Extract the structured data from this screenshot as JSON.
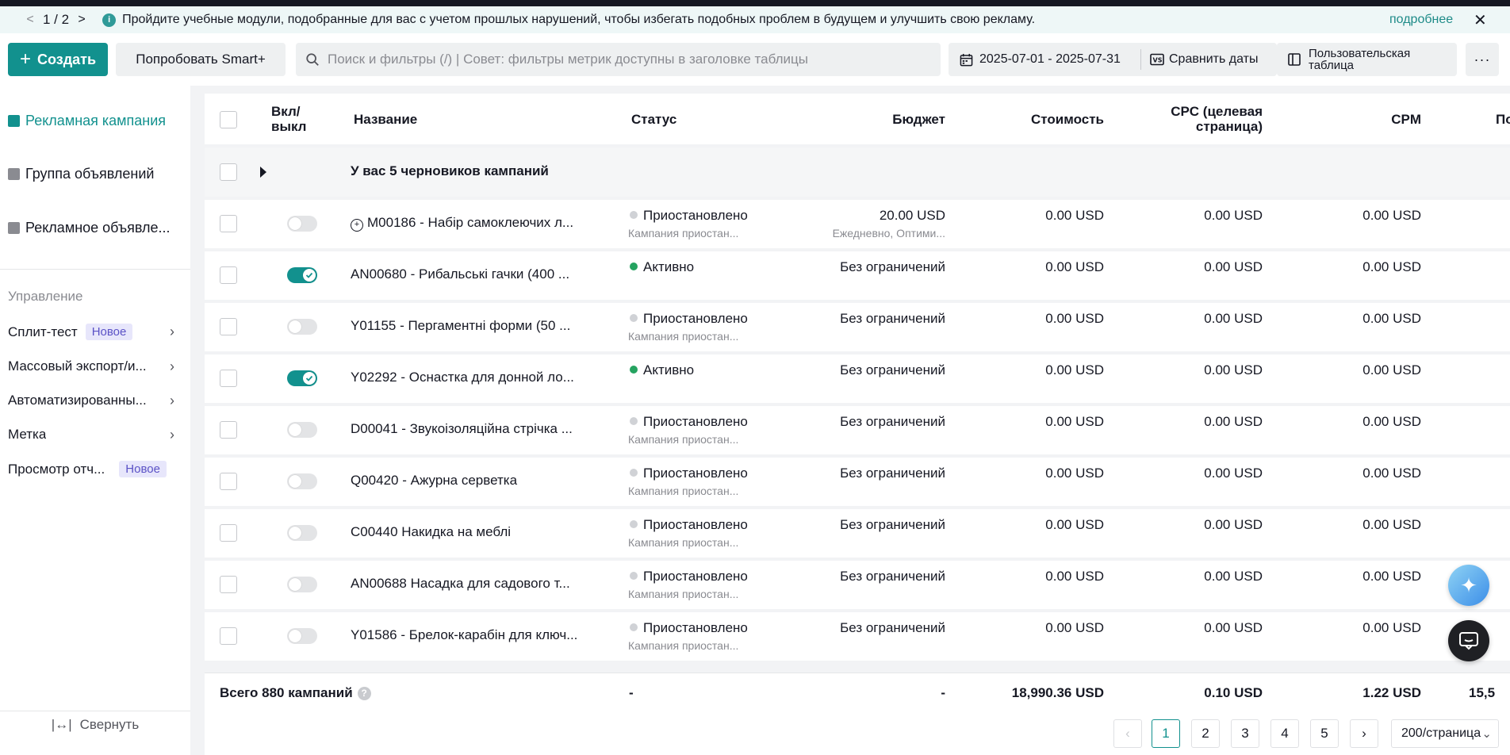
{
  "banner": {
    "page": "1 / 2",
    "message": "Пройдите учебные модули, подобранные для вас с учетом прошлых нарушений, чтобы избегать подобных проблем в будущем и улучшить свою рекламу.",
    "more": "подробнее"
  },
  "toolbar": {
    "create": "Создать",
    "try_smart": "Попробовать Smart+",
    "search_placeholder": "Поиск и фильтры (/) | Совет: фильтры метрик доступны в заголовке таблицы",
    "date_range": "2025-07-01 - 2025-07-31",
    "compare": "Сравнить даты",
    "custom_table": "Пользовательская таблица"
  },
  "sidebar": {
    "levels": [
      "Рекламная кампания",
      "Группа объявлений",
      "Рекламное объявле..."
    ],
    "section": "Управление",
    "links": [
      {
        "label": "Сплит-тест",
        "badge": "Новое"
      },
      {
        "label": "Массовый экспорт/и..."
      },
      {
        "label": "Автоматизированны..."
      },
      {
        "label": "Метка"
      },
      {
        "label": "Просмотр отч...",
        "badge": "Новое"
      }
    ],
    "collapse": "Свернуть"
  },
  "table": {
    "headers": {
      "toggle": "Вкл/ выкл",
      "name": "Название",
      "status": "Статус",
      "budget": "Бюджет",
      "cost": "Стоимость",
      "cpc": "CPC (целевая страница)",
      "cpm": "CPM",
      "next": "По"
    },
    "drafts": "У вас 5 черновиков кампаний",
    "rows": [
      {
        "on": false,
        "name": "M00186 - Набір самоклеючих л...",
        "status": "Приостановлено",
        "status_sub": "Кампания приостан...",
        "budget": "20.00 USD",
        "budget_sub": "Ежедневно, Оптими...",
        "cost": "0.00 USD",
        "cpc": "0.00 USD",
        "cpm": "0.00 USD"
      },
      {
        "on": true,
        "name": "AN00680 - Рибальські гачки (400 ...",
        "status": "Активно",
        "status_sub": "",
        "budget": "Без ограничений",
        "budget_sub": "",
        "cost": "0.00 USD",
        "cpc": "0.00 USD",
        "cpm": "0.00 USD"
      },
      {
        "on": false,
        "name": "Y01155 - Пергаментні форми (50 ...",
        "status": "Приостановлено",
        "status_sub": "Кампания приостан...",
        "budget": "Без ограничений",
        "budget_sub": "",
        "cost": "0.00 USD",
        "cpc": "0.00 USD",
        "cpm": "0.00 USD"
      },
      {
        "on": true,
        "name": "Y02292 - Оснастка для донной ло...",
        "status": "Активно",
        "status_sub": "",
        "budget": "Без ограничений",
        "budget_sub": "",
        "cost": "0.00 USD",
        "cpc": "0.00 USD",
        "cpm": "0.00 USD"
      },
      {
        "on": false,
        "name": "D00041 - Звукоізоляційна стрічка ...",
        "status": "Приостановлено",
        "status_sub": "Кампания приостан...",
        "budget": "Без ограничений",
        "budget_sub": "",
        "cost": "0.00 USD",
        "cpc": "0.00 USD",
        "cpm": "0.00 USD"
      },
      {
        "on": false,
        "name": "Q00420 - Ажурна серветка",
        "status": "Приостановлено",
        "status_sub": "Кампания приостан...",
        "budget": "Без ограничений",
        "budget_sub": "",
        "cost": "0.00 USD",
        "cpc": "0.00 USD",
        "cpm": "0.00 USD"
      },
      {
        "on": false,
        "name": "C00440 Накидка на меблі",
        "status": "Приостановлено",
        "status_sub": "Кампания приостан...",
        "budget": "Без ограничений",
        "budget_sub": "",
        "cost": "0.00 USD",
        "cpc": "0.00 USD",
        "cpm": "0.00 USD"
      },
      {
        "on": false,
        "name": "AN00688 Насадка для садового т...",
        "status": "Приостановлено",
        "status_sub": "Кампания приостан...",
        "budget": "Без ограничений",
        "budget_sub": "",
        "cost": "0.00 USD",
        "cpc": "0.00 USD",
        "cpm": "0.00 USD"
      },
      {
        "on": false,
        "name": "Y01586 - Брелок-карабін для ключ...",
        "status": "Приостановлено",
        "status_sub": "Кампания приостан...",
        "budget": "Без ограничений",
        "budget_sub": "",
        "cost": "0.00 USD",
        "cpc": "0.00 USD",
        "cpm": "0.00 USD"
      }
    ],
    "footer": {
      "total": "Всего 880 кампаний",
      "status": "-",
      "budget": "-",
      "cost": "18,990.36 USD",
      "cpc": "0.10 USD",
      "cpm": "1.22 USD",
      "next": "15,5"
    }
  },
  "pagination": {
    "pages": [
      "1",
      "2",
      "3",
      "4",
      "5"
    ],
    "current": "1",
    "page_size": "200/страница"
  },
  "colors": {
    "accent": "#12918e",
    "active_status": "#25a360",
    "badge_text": "#5b52c6"
  }
}
